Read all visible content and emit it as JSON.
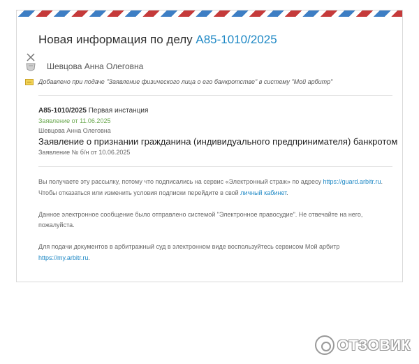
{
  "email": {
    "title_prefix": "Новая информация по делу",
    "case_number": "А85-1010/2025",
    "judge_name": "Шевцова Анна Олеговна",
    "note": "Добавлено при подаче \"Заявление физического лица о его банкротстве\" в систему \"Мой арбитр\""
  },
  "case": {
    "number": "А85-1010/2025",
    "instance": "Первая инстанция",
    "date_line": "Заявление от 11.06.2025",
    "person": "Шевцова Анна Олеговна",
    "doc_title": "Заявление о признании гражданина (индивидуального предпринимателя) банкротом",
    "doc_number": "Заявление № б/н от 10.06.2025"
  },
  "footer": {
    "p1_text": "Вы получаете эту рассылку, потому что подписались на сервис «Электронный страж» по адресу",
    "p1_link": "https://guard.arbitr.ru",
    "p1_text2": ". Чтобы отказаться или изменить условия подписки перейдите в свой",
    "p1_link2": "личный кабинет",
    "p1_end": ".",
    "p2": "Данное электронное сообщение было отправлено системой \"Электронное правосудие\". Не отвечайте на него, пожалуйста.",
    "p3_text": "Для подачи документов в арбитражный суд в электронном виде воспользуйтесь сервисом Мой арбитр",
    "p3_link": "https://my.arbitr.ru",
    "p3_end": "."
  },
  "watermark": {
    "text": "ОТЗОВИК"
  },
  "icons": {
    "judge": "judge-avatar-icon",
    "note": "note-icon",
    "logo": "otzovik-logo-icon"
  }
}
